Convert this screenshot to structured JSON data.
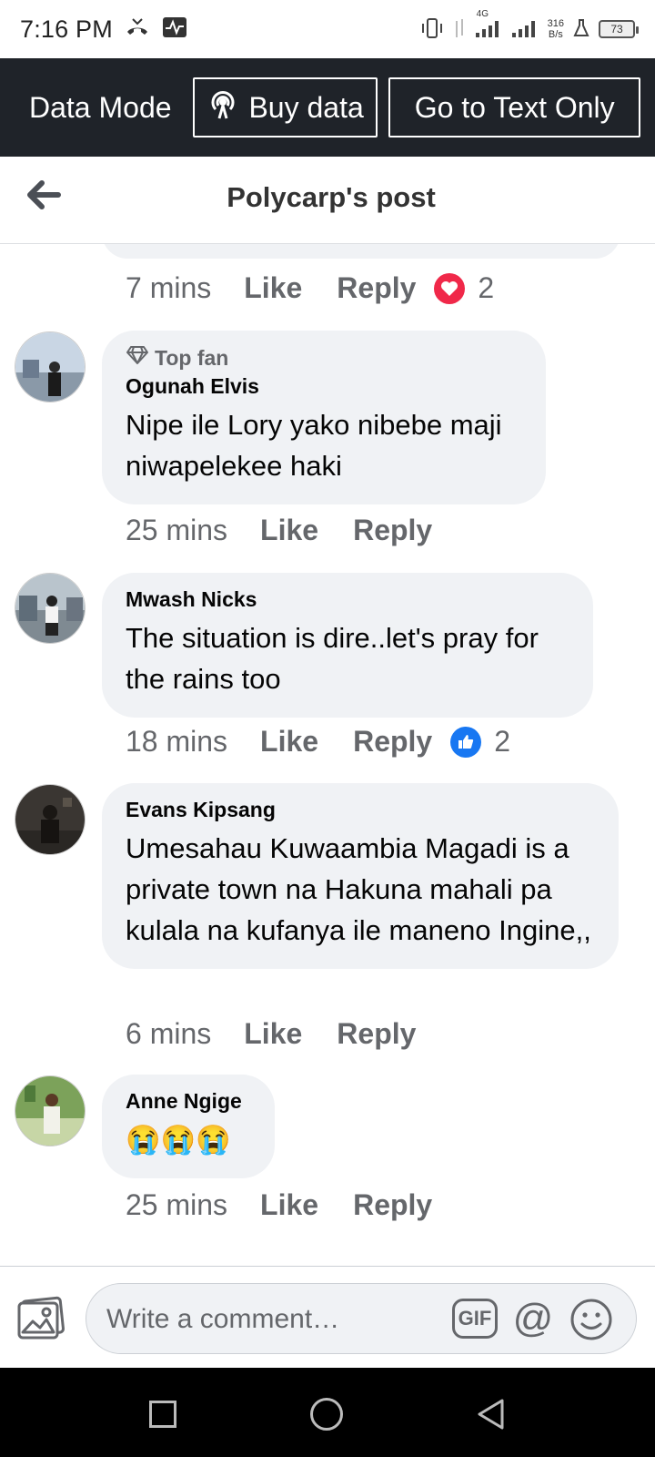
{
  "status_bar": {
    "time": "7:16 PM",
    "network_label": "4G",
    "speed_value": "316",
    "speed_unit": "B/s",
    "battery": "73"
  },
  "data_mode": {
    "label": "Data Mode",
    "buy_data": "Buy data",
    "text_only": "Go to Text Only"
  },
  "header": {
    "title": "Polycarp's post"
  },
  "previous_comment": {
    "time": "7 mins",
    "like": "Like",
    "reply": "Reply",
    "reaction_count": "2",
    "reaction": "heart-icon"
  },
  "comments": [
    {
      "badge": "Top fan",
      "author": "Ogunah Elvis",
      "text": "Nipe ile Lory yako nibebe maji niwapelekee haki",
      "time": "25 mins",
      "like": "Like",
      "reply": "Reply"
    },
    {
      "author": "Mwash Nicks",
      "text": "The situation is dire..let's pray for the rains too",
      "time": "18 mins",
      "like": "Like",
      "reply": "Reply",
      "reaction": "thumbs-up-icon",
      "reaction_count": "2"
    },
    {
      "author": "Evans Kipsang",
      "text": "Umesahau Kuwaambia Magadi is a private town na Hakuna mahali pa kulala na kufanya ile maneno Ingine,,",
      "time": "6 mins",
      "like": "Like",
      "reply": "Reply"
    },
    {
      "author": "Anne Ngige",
      "text": "😭😭😭",
      "time": "25 mins",
      "like": "Like",
      "reply": "Reply"
    }
  ],
  "composer": {
    "placeholder": "Write a comment…",
    "gif": "GIF",
    "mention": "@"
  },
  "colors": {
    "data_bar_bg": "#1f2329",
    "bubble_bg": "#f0f2f5",
    "muted_text": "#65676b",
    "like_blue": "#1877f2",
    "heart_red": "#f02849"
  }
}
